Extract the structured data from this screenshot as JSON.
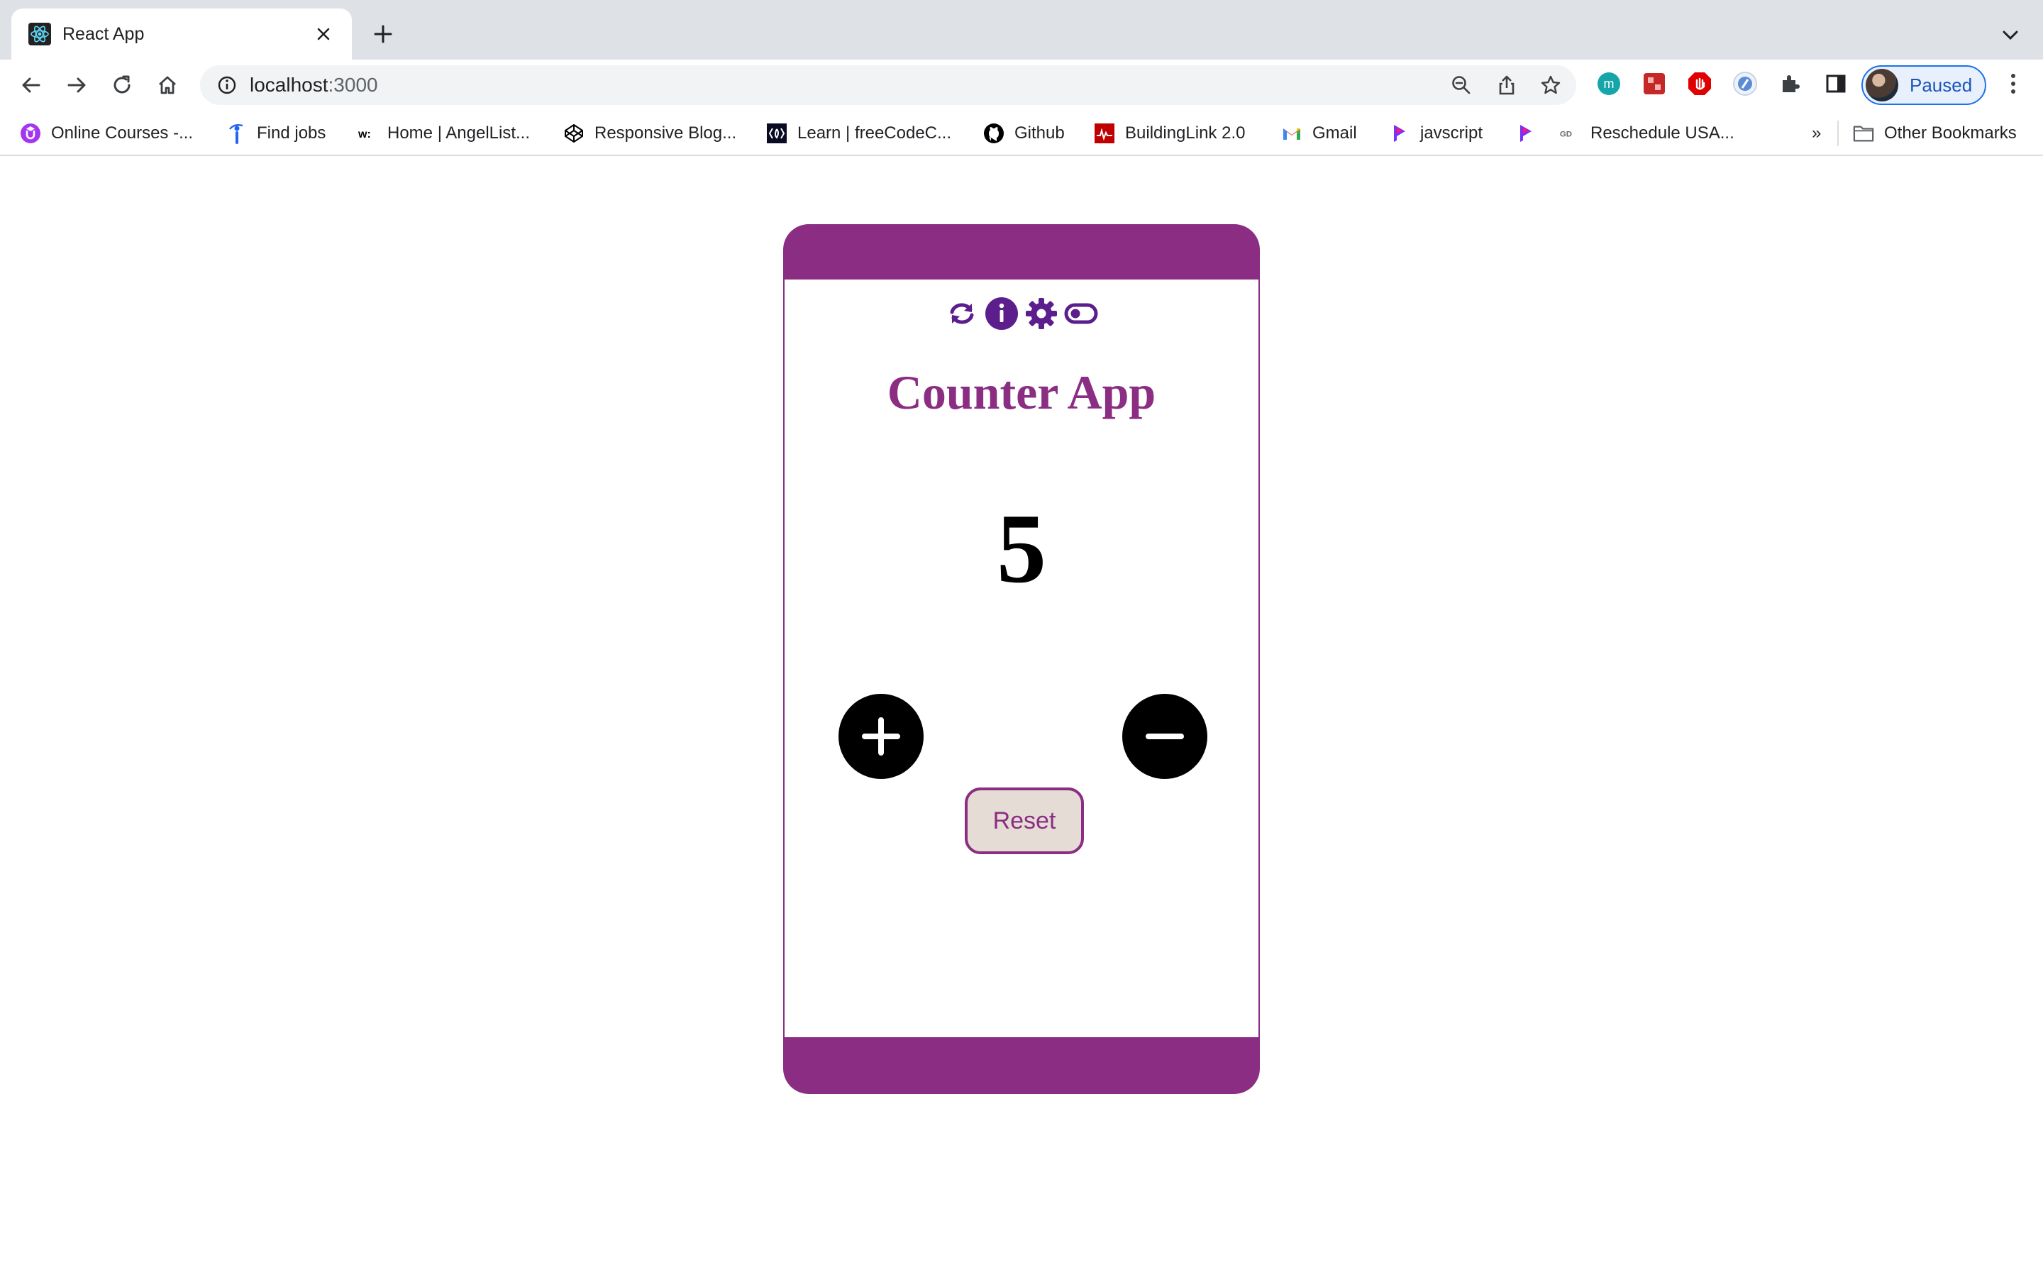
{
  "browser": {
    "tab": {
      "title": "React App",
      "favicon": "react-logo-icon"
    },
    "address": {
      "host": "localhost",
      "port": ":3000"
    },
    "profile": {
      "label": "Paused"
    },
    "bookmarks": [
      {
        "label": "Online Courses -...",
        "icon": "udemy-icon",
        "color": "#a435f0"
      },
      {
        "label": "Find jobs",
        "icon": "indeed-icon",
        "color": "#2164f3"
      },
      {
        "label": "Home | AngelList...",
        "icon": "angellist-icon",
        "color": "#000000"
      },
      {
        "label": "Responsive Blog...",
        "icon": "codepen-icon",
        "color": "#000000"
      },
      {
        "label": "Learn | freeCodeC...",
        "icon": "freecodecamp-icon",
        "color": "#0a0a23"
      },
      {
        "label": "Github",
        "icon": "github-icon",
        "color": "#000000"
      },
      {
        "label": "BuildingLink 2.0",
        "icon": "buildinglink-icon",
        "color": "#c00000"
      },
      {
        "label": "Gmail",
        "icon": "gmail-icon",
        "color": "#ea4335"
      },
      {
        "label": "javscript",
        "icon": "pluralsight-icon",
        "color": "#7b2ff7"
      },
      {
        "label": "",
        "icon": "pluralsight-icon",
        "color": "#7b2ff7"
      },
      {
        "label": "Reschedule  USA...",
        "icon": "gd-icon",
        "color": "#6b6b6b"
      }
    ],
    "bookmarks_overflow": "»",
    "other_bookmarks": "Other Bookmarks"
  },
  "app": {
    "title": "Counter App",
    "count": "5",
    "reset_label": "Reset",
    "accent_color": "#8b2d82",
    "header_icons": [
      "refresh-icon",
      "info-icon",
      "settings-icon",
      "toggle-icon"
    ]
  }
}
